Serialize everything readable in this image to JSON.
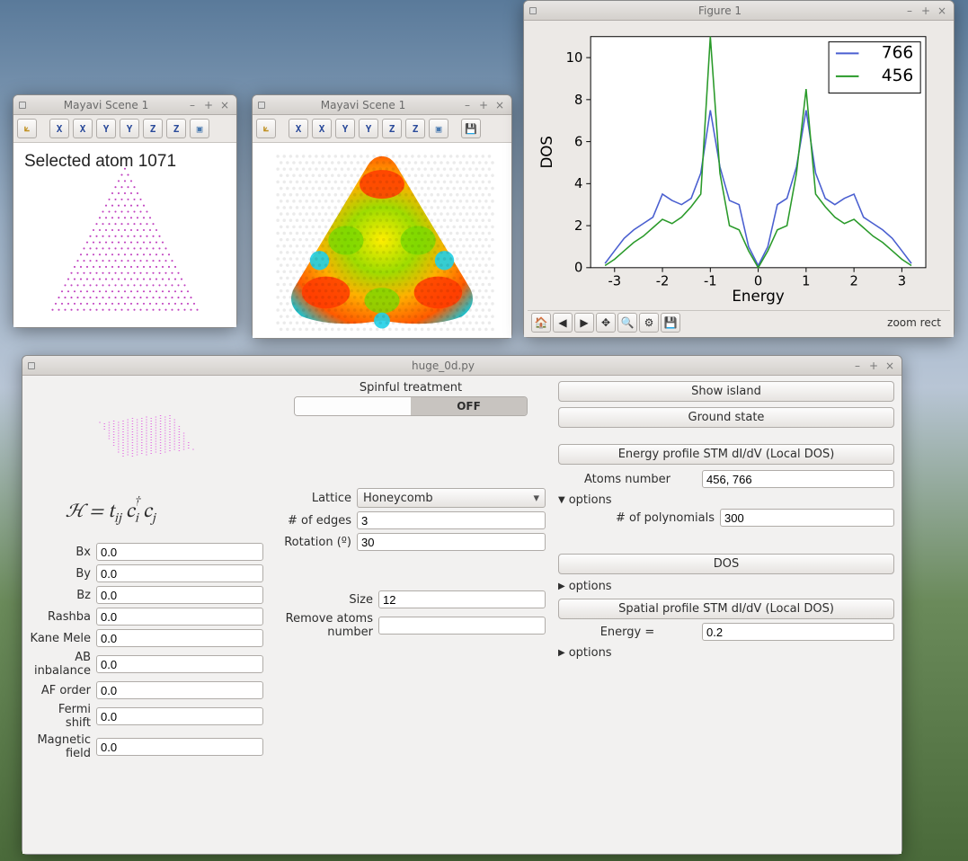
{
  "mayavi1": {
    "title": "Mayavi Scene 1",
    "selected_label": "Selected atom 1071",
    "toolbar": {
      "xp": "X",
      "xn": "X",
      "yp": "Y",
      "yn": "Y",
      "zp": "Z",
      "zn": "Z"
    }
  },
  "mayavi2": {
    "title": "Mayavi Scene 1",
    "toolbar": {
      "xp": "X",
      "xn": "X",
      "yp": "Y",
      "yn": "Y",
      "zp": "Z",
      "zn": "Z"
    }
  },
  "figure": {
    "title": "Figure 1",
    "status": "zoom rect",
    "chart_data": {
      "type": "line",
      "xlabel": "Energy",
      "ylabel": "DOS",
      "xlim": [
        -3.5,
        3.5
      ],
      "ylim": [
        0,
        11
      ],
      "xticks": [
        -3,
        -2,
        -1,
        0,
        1,
        2,
        3
      ],
      "yticks": [
        0,
        2,
        4,
        6,
        8,
        10
      ],
      "series": [
        {
          "name": "766",
          "color": "#4a5fd0",
          "x": [
            -3.2,
            -3.0,
            -2.8,
            -2.6,
            -2.4,
            -2.2,
            -2.0,
            -1.8,
            -1.6,
            -1.4,
            -1.2,
            -1.0,
            -0.8,
            -0.6,
            -0.4,
            -0.2,
            0.0,
            0.2,
            0.4,
            0.6,
            0.8,
            1.0,
            1.2,
            1.4,
            1.6,
            1.8,
            2.0,
            2.2,
            2.4,
            2.6,
            2.8,
            3.0,
            3.2
          ],
          "y": [
            0.2,
            0.8,
            1.4,
            1.8,
            2.1,
            2.4,
            3.5,
            3.2,
            3.0,
            3.3,
            4.5,
            7.5,
            4.8,
            3.2,
            3.0,
            1.0,
            0.1,
            1.0,
            3.0,
            3.3,
            4.8,
            7.5,
            4.5,
            3.3,
            3.0,
            3.3,
            3.5,
            2.4,
            2.1,
            1.8,
            1.4,
            0.8,
            0.2
          ]
        },
        {
          "name": "456",
          "color": "#2a9a2a",
          "x": [
            -3.2,
            -3.0,
            -2.8,
            -2.6,
            -2.4,
            -2.2,
            -2.0,
            -1.8,
            -1.6,
            -1.4,
            -1.2,
            -1.0,
            -0.8,
            -0.6,
            -0.4,
            -0.2,
            0.0,
            0.2,
            0.4,
            0.6,
            0.8,
            1.0,
            1.2,
            1.4,
            1.6,
            1.8,
            2.0,
            2.2,
            2.4,
            2.6,
            2.8,
            3.0,
            3.2
          ],
          "y": [
            0.1,
            0.4,
            0.8,
            1.2,
            1.5,
            1.9,
            2.3,
            2.1,
            2.4,
            2.9,
            3.5,
            11.0,
            4.5,
            2.0,
            1.8,
            0.8,
            0.0,
            0.8,
            1.8,
            2.0,
            4.5,
            8.5,
            3.5,
            2.9,
            2.4,
            2.1,
            2.3,
            1.9,
            1.5,
            1.2,
            0.8,
            0.4,
            0.1
          ]
        }
      ]
    }
  },
  "panel": {
    "title": "huge_0d.py",
    "spinful_label": "Spinful treatment",
    "spinful_off": "OFF",
    "hamiltonian_tex": "ℋ = t_{ij} c_i^† c_j",
    "fields": {
      "bx": {
        "label": "Bx",
        "value": "0.0"
      },
      "by": {
        "label": "By",
        "value": "0.0"
      },
      "bz": {
        "label": "Bz",
        "value": "0.0"
      },
      "rashba": {
        "label": "Rashba",
        "value": "0.0"
      },
      "kane": {
        "label": "Kane Mele",
        "value": "0.0"
      },
      "ab": {
        "label": "AB inbalance",
        "value": "0.0"
      },
      "af": {
        "label": "AF order",
        "value": "0.0"
      },
      "fermi": {
        "label": "Fermi shift",
        "value": "0.0"
      },
      "mag": {
        "label": "Magnetic field",
        "value": "0.0"
      }
    },
    "lattice": {
      "label": "Lattice",
      "value": "Honeycomb",
      "edges_label": "# of edges",
      "edges": "3",
      "rot_label": "Rotation (º)",
      "rot": "30",
      "size_label": "Size",
      "size": "12",
      "remove_label": "Remove atoms number",
      "remove": ""
    },
    "right": {
      "show_island": "Show island",
      "ground_state": "Ground state",
      "energy_profile": "Energy profile STM dI/dV (Local DOS)",
      "atoms_label": "Atoms number",
      "atoms": "456, 766",
      "options": "options",
      "poly_label": "# of polynomials",
      "poly": "300",
      "dos": "DOS",
      "spatial": "Spatial profile STM dI/dV (Local DOS)",
      "energy_eq_label": "Energy =",
      "energy_eq": "0.2"
    }
  }
}
